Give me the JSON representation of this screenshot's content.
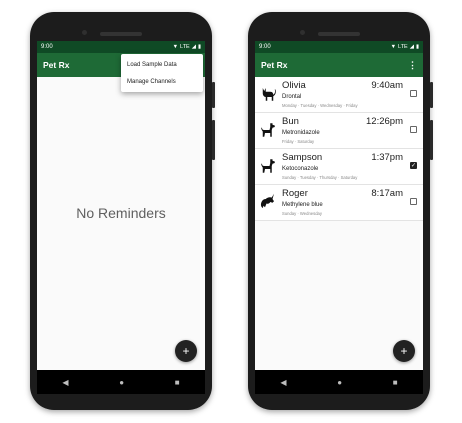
{
  "left": {
    "status_time": "9:00",
    "status_net": "LTE",
    "app_title": "Pet Rx",
    "menu": [
      "Load Sample Data",
      "Manage Channels"
    ],
    "empty_text": "No Reminders",
    "fab": "+",
    "nav": {
      "back": "◀",
      "home": "●",
      "recents": "■"
    }
  },
  "right": {
    "status_time": "9:00",
    "status_net": "LTE",
    "app_title": "Pet Rx",
    "overflow": "⋮",
    "fab": "+",
    "nav": {
      "back": "◀",
      "home": "●",
      "recents": "■"
    },
    "reminders": [
      {
        "name": "Olivia",
        "time": "9:40am",
        "medication": "Drontal",
        "days": "Monday · Tuesday · Wednesday · Friday",
        "icon": "cat-icon",
        "checked": false
      },
      {
        "name": "Bun",
        "time": "12:26pm",
        "medication": "Metronidazole",
        "days": "Friday · Saturday",
        "icon": "dog-icon",
        "checked": false
      },
      {
        "name": "Sampson",
        "time": "1:37pm",
        "medication": "Ketoconazole",
        "days": "Sunday · Tuesday · Thursday · Saturday",
        "icon": "dog-icon",
        "checked": true
      },
      {
        "name": "Roger",
        "time": "8:17am",
        "medication": "Methylene blue",
        "days": "Sunday · Wednesday",
        "icon": "unicorn-icon",
        "checked": false
      }
    ]
  },
  "colors": {
    "status_bar": "#0f4a25",
    "app_bar": "#1e6a36",
    "fab": "#222222"
  }
}
